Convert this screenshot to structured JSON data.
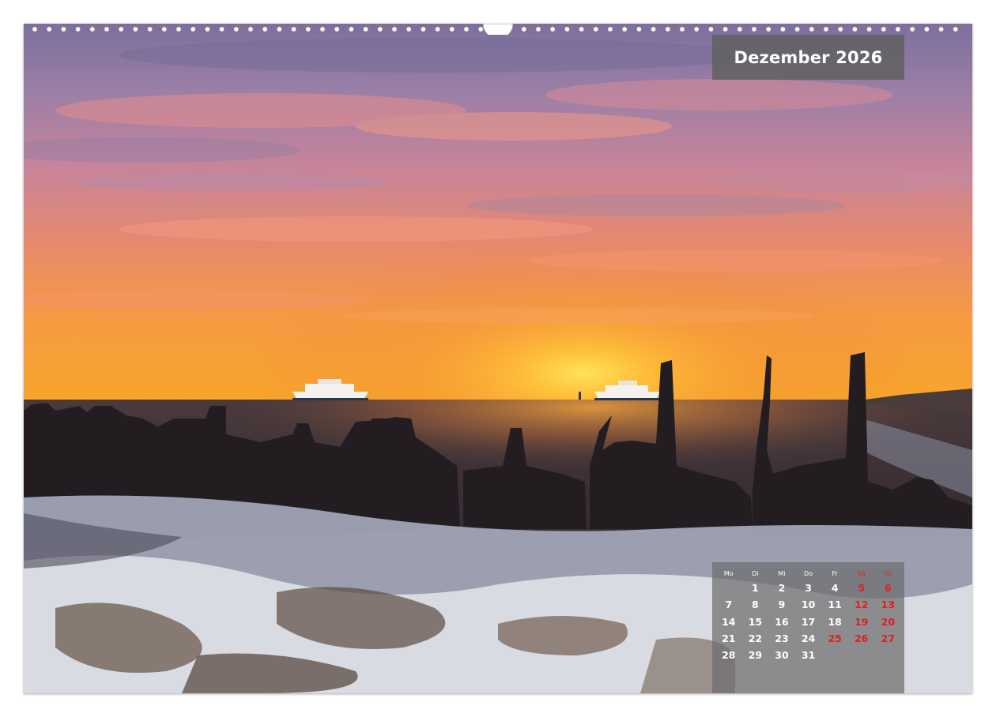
{
  "calendar": {
    "month_title": "Dezember 2026",
    "weekdays": [
      "Mo",
      "Di",
      "Mi",
      "Do",
      "Fr",
      "Sa",
      "So"
    ],
    "weekend_color": "#e0201c",
    "weeks": [
      [
        "",
        "1",
        "2",
        "3",
        "4",
        "5",
        "6"
      ],
      [
        "7",
        "8",
        "9",
        "10",
        "11",
        "12",
        "13"
      ],
      [
        "14",
        "15",
        "16",
        "17",
        "18",
        "19",
        "20"
      ],
      [
        "21",
        "22",
        "23",
        "24",
        "25",
        "26",
        "27"
      ],
      [
        "28",
        "29",
        "30",
        "31",
        "",
        "",
        ""
      ]
    ],
    "highlighted_holidays": [
      "25",
      "26"
    ]
  },
  "photo": {
    "subject": "sunset-over-sea-with-shipwreck"
  }
}
